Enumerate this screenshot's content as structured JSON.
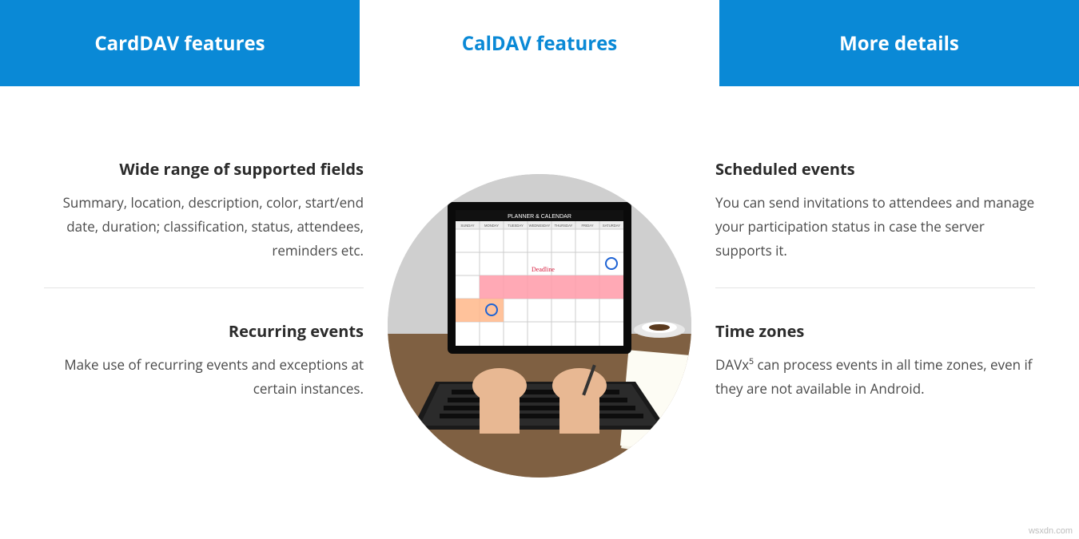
{
  "tabs": [
    {
      "label": "CardDAV features",
      "active": false
    },
    {
      "label": "CalDAV features",
      "active": true
    },
    {
      "label": "More details",
      "active": false
    }
  ],
  "left": {
    "feature1": {
      "title": "Wide range of supported fields",
      "body": "Summary, location, description, color, start/end date, duration; classification, status, attendees, reminders etc."
    },
    "feature2": {
      "title": "Recurring events",
      "body": "Make use of recurring events and exceptions at certain instances."
    }
  },
  "right": {
    "feature1": {
      "title": "Scheduled events",
      "body": "You can send invitations to attendees and manage your participation status in case the server supports it."
    },
    "feature2": {
      "title": "Time zones",
      "body": "DAVx⁵ can process events in all time zones, even if they are not available in Android."
    }
  },
  "center_image_alt": "Laptop showing planner and calendar",
  "center_image_caption": "PLANNER & CALENDAR",
  "watermark": "wsxdn.com"
}
